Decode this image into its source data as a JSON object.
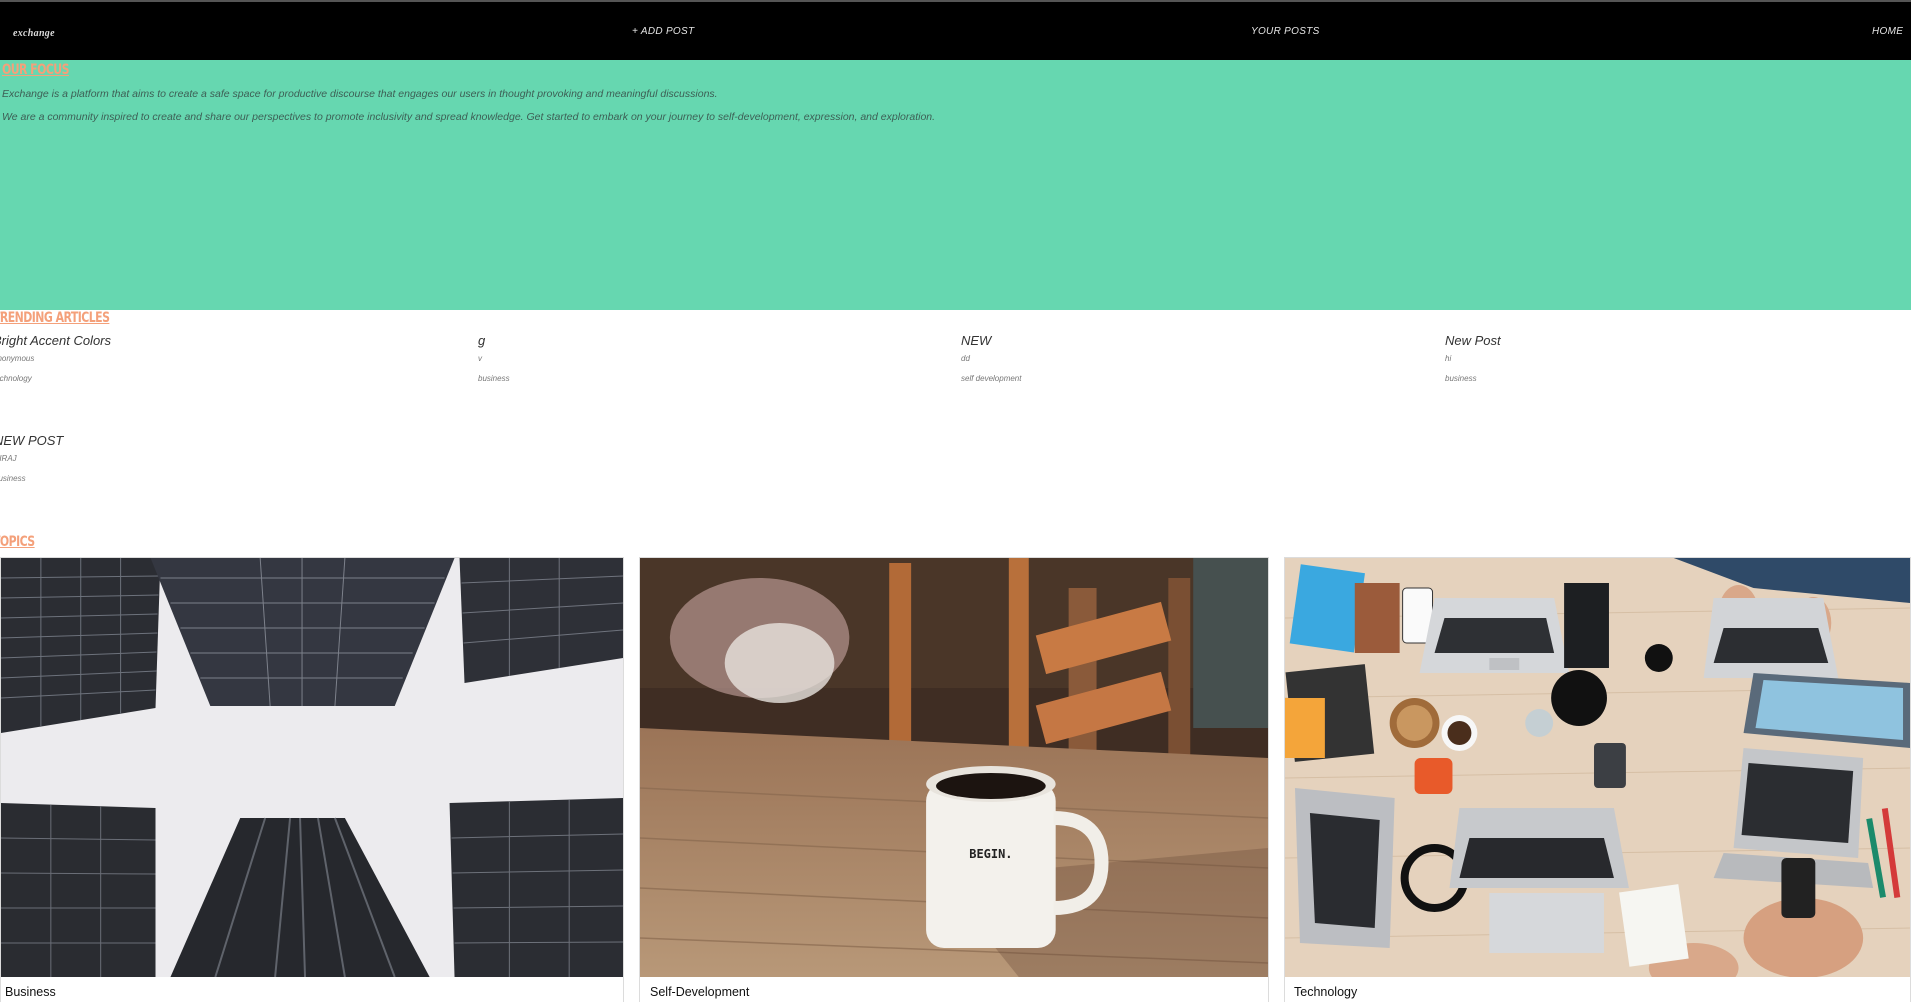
{
  "nav": {
    "brand": "exchange",
    "add_post": "+ ADD POST",
    "your_posts": "YOUR POSTS",
    "home": "HOME"
  },
  "hero": {
    "title": "OUR FOCUS",
    "line1": "Exchange is a platform that aims to create a safe space for productive discourse that engages our users in thought provoking and meaningful discussions.",
    "line2": "We are a community inspired to create and share our perspectives to promote inclusivity and spread knowledge. Get started to embark on your journey to self-development, expression, and exploration."
  },
  "trending": {
    "title": "TRENDING ARTICLES",
    "articles": [
      {
        "title": "Bright Accent Colors",
        "author": "anonymous",
        "topic": "technology"
      },
      {
        "title": "g",
        "author": "v",
        "topic": "business"
      },
      {
        "title": "NEW",
        "author": "dd",
        "topic": "self development"
      },
      {
        "title": "New Post",
        "author": "hi",
        "topic": "business"
      },
      {
        "title": "NEW POST",
        "author": "SIRAJ",
        "topic": "business"
      }
    ]
  },
  "topics": {
    "title": "TOPICS",
    "cards": [
      {
        "label": "Business",
        "image": "skyscrapers-photo"
      },
      {
        "label": "Self-Development",
        "image": "coffee-mug-begin-photo"
      },
      {
        "label": "Technology",
        "image": "laptops-desk-photo"
      }
    ],
    "mug_text": "BEGIN."
  }
}
